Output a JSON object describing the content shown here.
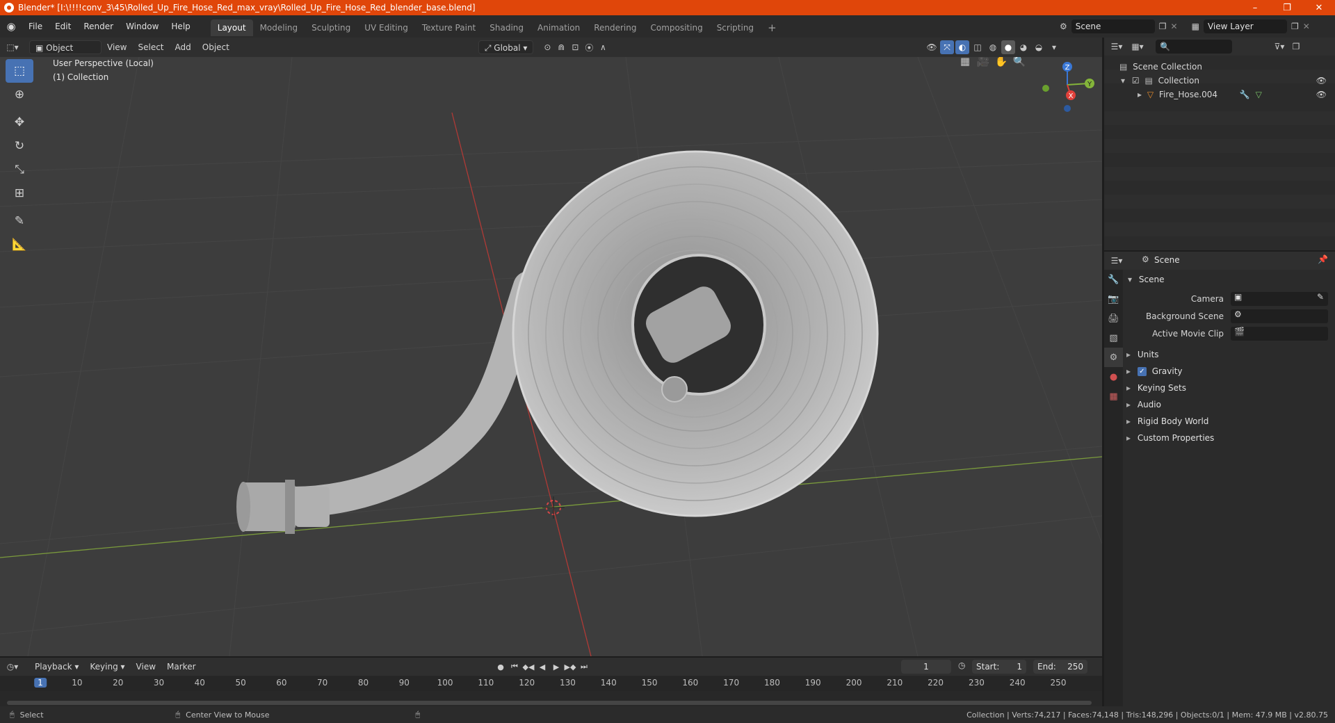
{
  "titlebar": {
    "title": "Blender* [I:\\!!!!conv_3\\45\\Rolled_Up_Fire_Hose_Red_max_vray\\Rolled_Up_Fire_Hose_Red_blender_base.blend]",
    "minimize": "–",
    "maximize": "❐",
    "close": "✕"
  },
  "menubar": {
    "items": [
      "File",
      "Edit",
      "Render",
      "Window",
      "Help"
    ],
    "workspaces": [
      "Layout",
      "Modeling",
      "Sculpting",
      "UV Editing",
      "Texture Paint",
      "Shading",
      "Animation",
      "Rendering",
      "Compositing",
      "Scripting"
    ],
    "add_tab": "+",
    "scene": "Scene",
    "view_layer": "View Layer"
  },
  "viewport": {
    "mode": "Object Mode",
    "menus": [
      "View",
      "Select",
      "Add",
      "Object"
    ],
    "transform": "Global",
    "perspective_label": "User Perspective (Local)",
    "collection_label": "(1) Collection",
    "gizmo": {
      "x": "X",
      "y": "Y",
      "z": "Z"
    }
  },
  "outliner": {
    "search_placeholder": "",
    "rows": [
      {
        "label": "Scene Collection"
      },
      {
        "label": "Collection"
      },
      {
        "label": "Fire_Hose.004"
      }
    ]
  },
  "properties": {
    "context": "Scene",
    "section": "Scene",
    "fields": {
      "camera": "Camera",
      "background_scene": "Background Scene",
      "active_movie_clip": "Active Movie Clip"
    },
    "panels": [
      "Units",
      "Gravity",
      "Keying Sets",
      "Audio",
      "Rigid Body World",
      "Custom Properties"
    ]
  },
  "timeline": {
    "menus": [
      "Playback",
      "Keying",
      "View",
      "Marker"
    ],
    "current_frame": "1",
    "start_label": "Start:",
    "start": "1",
    "end_label": "End:",
    "end": "250",
    "ticks": [
      "1",
      "10",
      "20",
      "30",
      "40",
      "50",
      "60",
      "70",
      "80",
      "90",
      "100",
      "110",
      "120",
      "130",
      "140",
      "150",
      "160",
      "170",
      "180",
      "190",
      "200",
      "210",
      "220",
      "230",
      "240",
      "250"
    ]
  },
  "statusbar": {
    "left": "Select",
    "middle": "Center View to Mouse",
    "right": "Collection | Verts:74,217 | Faces:74,148 | Tris:148,296 | Objects:0/1 | Mem: 47.9 MB | v2.80.75"
  },
  "colors": {
    "accent": "#4772b3",
    "titlebar": "#e0460a",
    "x_axis": "#e0403a",
    "y_axis": "#84b53a",
    "z_axis": "#3a78d6"
  }
}
